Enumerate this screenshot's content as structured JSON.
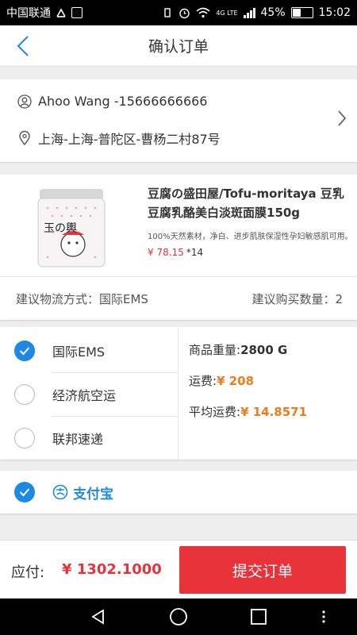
{
  "status_bar": {
    "carrier": "中国联通",
    "network": "4G LTE",
    "battery": "45%",
    "battery_level": 0.45,
    "time": "15:02"
  },
  "header": {
    "title": "确认订单"
  },
  "address": {
    "contact": "Ahoo Wang -15666666666",
    "location": "上海-上海-普陀区-曹杨二村87号"
  },
  "product": {
    "name": "豆腐の盛田屋/Tofu-moritaya 豆乳豆腐乳酪美白淡斑面膜150g",
    "description": "100%天然素材，净白、进步肌肤保湿性孕妇敏感肌可用。",
    "price": "¥ 78.15",
    "quantity": "*14",
    "image_text": "玉の輿"
  },
  "suggestion": {
    "shipping_method": "建议物流方式：国际EMS",
    "quantity": "建议购买数量：2"
  },
  "shipping_options": [
    {
      "label": "国际EMS",
      "selected": true
    },
    {
      "label": "经济航空运",
      "selected": false
    },
    {
      "label": "联邦速递",
      "selected": false
    }
  ],
  "shipping_info": {
    "weight_label": "商品重量:",
    "weight_value": "2800 G",
    "fee_label": "运费:",
    "fee_value": "¥ 208",
    "avg_label": "平均运费:",
    "avg_value": "¥ 14.8571"
  },
  "payment": {
    "method": "支付宝",
    "selected": true
  },
  "bottom": {
    "pay_label": "应付:",
    "amount": "¥ 1302.1000",
    "submit_label": "提交订单"
  },
  "colors": {
    "accent_blue": "#1e88e5",
    "price_red": "#e8333b",
    "fee_orange": "#f07b1d"
  }
}
